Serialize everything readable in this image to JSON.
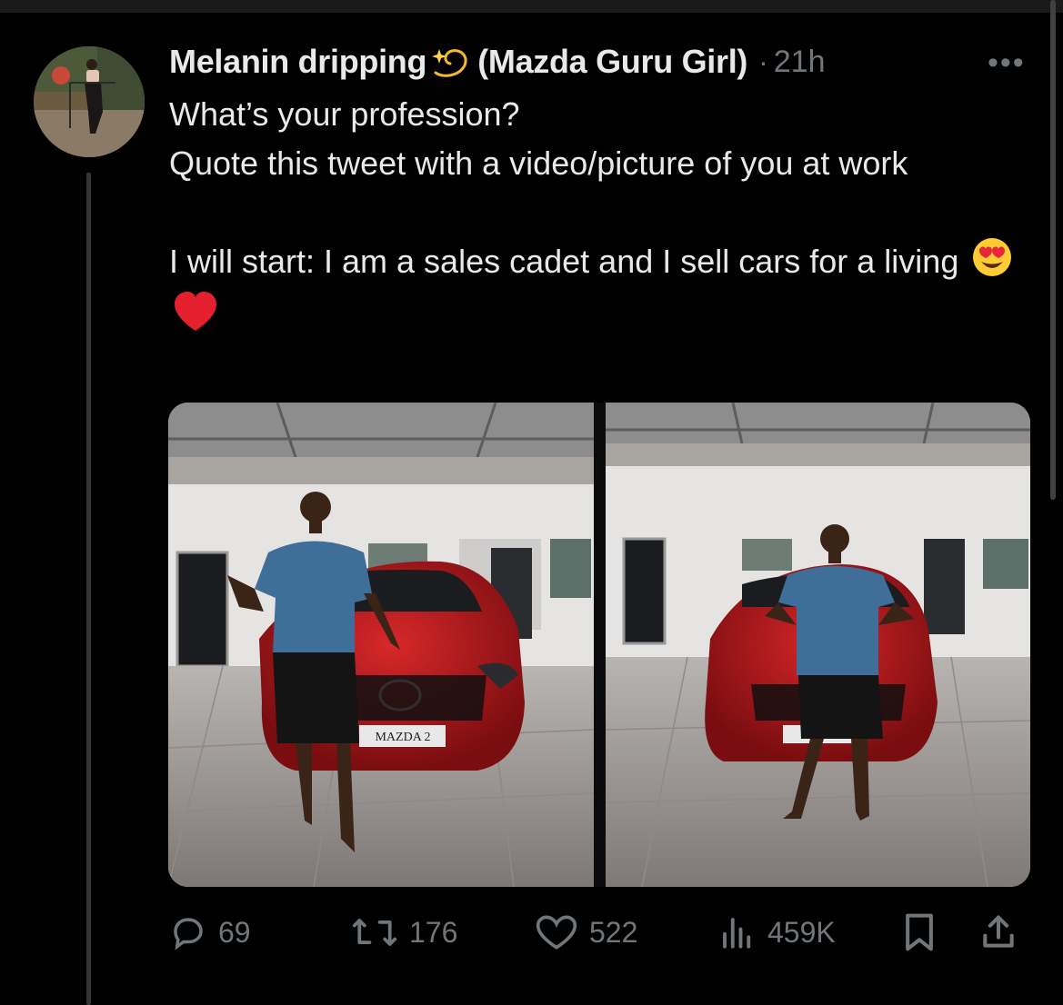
{
  "tweet": {
    "display_name": "Melanin dripping",
    "display_name_suffix": "(Mazda Guru Girl)",
    "separator": "·",
    "time": "21h",
    "more": "•••",
    "text_lines": [
      "What’s your profession?",
      "Quote this tweet with a video/picture of you at work",
      "I will start: I am a sales cadet and I sell cars for a living"
    ],
    "emojis": [
      "dizzy-star",
      "heart-eyes",
      "red-heart"
    ]
  },
  "media": {
    "photos": [
      {
        "plate_text": "MAZDA 2"
      },
      {
        "plate_text": ""
      }
    ]
  },
  "actions": {
    "replies": "69",
    "reposts": "176",
    "likes": "522",
    "views": "459K"
  },
  "colors": {
    "background": "#000000",
    "text": "#e7e9ea",
    "secondary": "#71767b",
    "car_red": "#b0151a"
  }
}
